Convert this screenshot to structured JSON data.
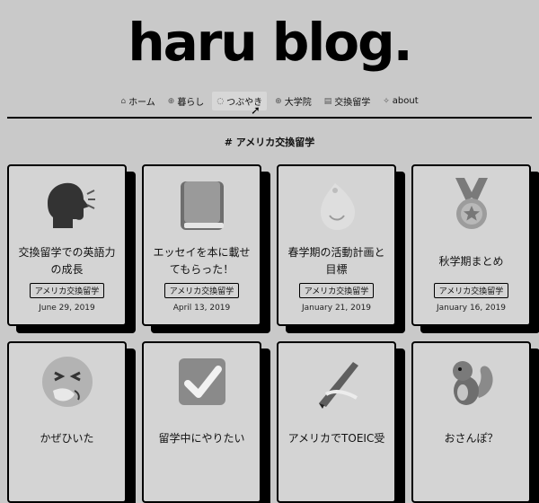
{
  "site": {
    "title": "haru blog."
  },
  "nav": [
    {
      "label": "ホーム",
      "icon": "house-icon"
    },
    {
      "label": "暮らし",
      "icon": "globe-icon"
    },
    {
      "label": "つぶやき",
      "icon": "speech-bubble-icon"
    },
    {
      "label": "大学院",
      "icon": "school-icon"
    },
    {
      "label": "交換留学",
      "icon": "us-flag-icon"
    },
    {
      "label": "about",
      "icon": "sparkle-icon"
    }
  ],
  "tag_heading": "# アメリカ交換留学",
  "posts": [
    {
      "title": "交換留学での英語力の成長",
      "tag": "アメリカ交換留学",
      "date": "June 29, 2019",
      "icon": "speaking-head-icon"
    },
    {
      "title": "エッセイを本に載せてもらった！",
      "tag": "アメリカ交換留学",
      "date": "April 13, 2019",
      "icon": "book-icon"
    },
    {
      "title": "春学期の活動計画と目標",
      "tag": "アメリカ交換留学",
      "date": "January 21, 2019",
      "icon": "sprout-icon"
    },
    {
      "title": "秋学期まとめ",
      "tag": "アメリカ交換留学",
      "date": "January 16, 2019",
      "icon": "medal-icon"
    },
    {
      "title": "かぜひいた",
      "tag": "",
      "date": "",
      "icon": "sneezing-face-icon"
    },
    {
      "title": "留学中にやりたい",
      "tag": "",
      "date": "",
      "icon": "check-box-icon"
    },
    {
      "title": "アメリカでTOEIC受",
      "tag": "",
      "date": "",
      "icon": "pen-icon"
    },
    {
      "title": "おさんぽ？",
      "tag": "",
      "date": "",
      "icon": "chipmunk-icon"
    }
  ]
}
